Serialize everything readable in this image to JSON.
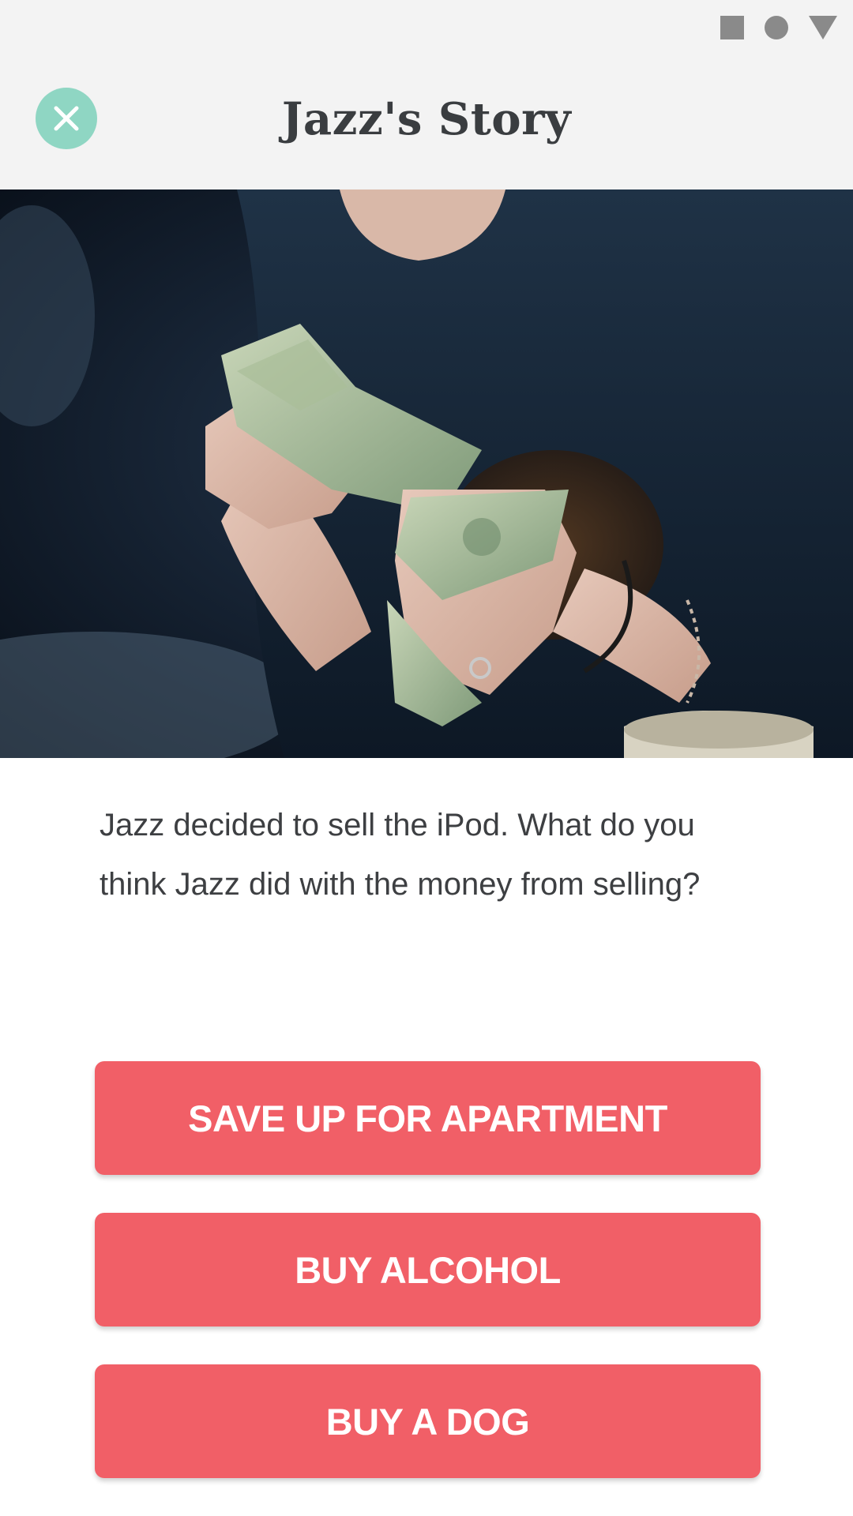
{
  "status_bar": {
    "icons": [
      "square-icon",
      "circle-icon",
      "triangle-icon"
    ]
  },
  "header": {
    "title": "Jazz's Story",
    "close_icon": "close-icon",
    "close_color": "#8fd6c3"
  },
  "story": {
    "text": "Jazz decided to sell the iPod. What do you think Jazz did with the money from selling?"
  },
  "choices": [
    {
      "label": "SAVE UP FOR APARTMENT"
    },
    {
      "label": "BUY ALCOHOL"
    },
    {
      "label": "BUY A DOG"
    }
  ],
  "colors": {
    "header_bg": "#f3f3f3",
    "button_bg": "#f15f67",
    "button_text": "#ffffff",
    "title_text": "#3a3d40"
  }
}
